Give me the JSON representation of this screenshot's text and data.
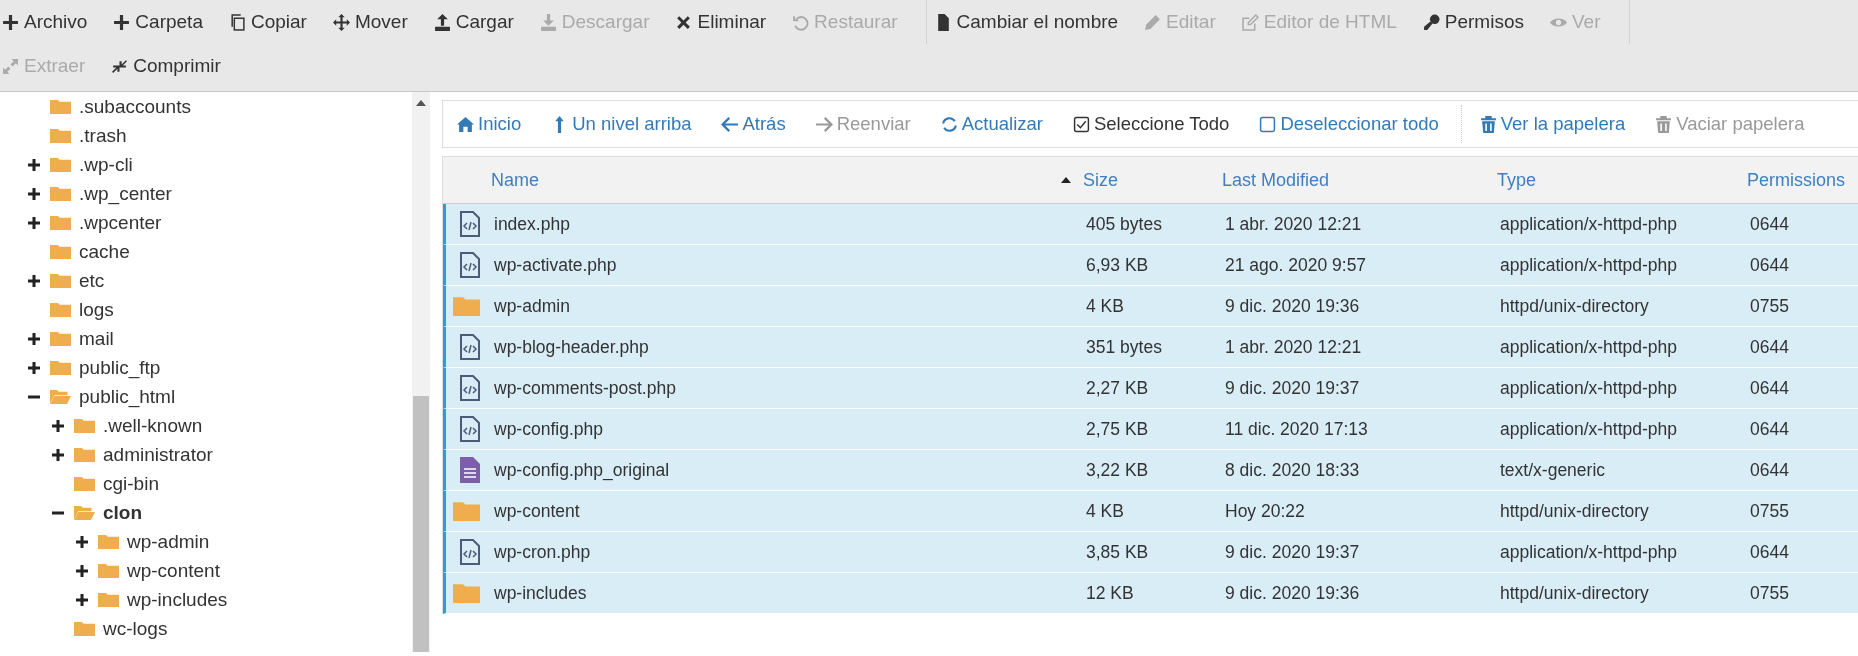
{
  "toolbar": {
    "groups": [
      {
        "items": [
          {
            "label": "Archivo",
            "disabled": false
          },
          {
            "label": "Carpeta",
            "disabled": false
          },
          {
            "label": "Copiar",
            "disabled": false
          },
          {
            "label": "Mover",
            "disabled": false
          },
          {
            "label": "Cargar",
            "disabled": false
          },
          {
            "label": "Descargar",
            "disabled": true
          },
          {
            "label": "Eliminar",
            "disabled": false
          },
          {
            "label": "Restaurar",
            "disabled": true
          }
        ]
      },
      {
        "items": [
          {
            "label": "Cambiar el nombre",
            "disabled": false
          },
          {
            "label": "Editar",
            "disabled": true
          },
          {
            "label": "Editor de HTML",
            "disabled": true
          },
          {
            "label": "Permisos",
            "disabled": false
          },
          {
            "label": "Ver",
            "disabled": true
          }
        ]
      },
      {
        "items": [
          {
            "label": "Extraer",
            "disabled": true
          },
          {
            "label": "Comprimir",
            "disabled": false
          }
        ]
      }
    ]
  },
  "tree": [
    {
      "label": ".subaccounts",
      "selected": false
    },
    {
      "label": ".trash",
      "selected": false
    },
    {
      "label": ".wp-cli",
      "selected": false,
      "expanded": false
    },
    {
      "label": ".wp_center",
      "selected": false,
      "expanded": false
    },
    {
      "label": ".wpcenter",
      "selected": false,
      "expanded": false
    },
    {
      "label": "cache",
      "selected": false
    },
    {
      "label": "etc",
      "selected": false,
      "expanded": false
    },
    {
      "label": "logs",
      "selected": false
    },
    {
      "label": "mail",
      "selected": false,
      "expanded": false
    },
    {
      "label": "public_ftp",
      "selected": false,
      "expanded": false
    },
    {
      "label": "public_html",
      "selected": false,
      "expanded": true,
      "children": [
        {
          "label": ".well-known",
          "selected": false,
          "expanded": false
        },
        {
          "label": "administrator",
          "selected": false,
          "expanded": false
        },
        {
          "label": "cgi-bin",
          "selected": false
        },
        {
          "label": "clon",
          "selected": true,
          "expanded": true,
          "children": [
            {
              "label": "wp-admin",
              "selected": false,
              "expanded": false
            },
            {
              "label": "wp-content",
              "selected": false,
              "expanded": false
            },
            {
              "label": "wp-includes",
              "selected": false,
              "expanded": false
            }
          ]
        },
        {
          "label": "wc-logs",
          "selected": false
        }
      ]
    }
  ],
  "nav": {
    "groups": [
      {
        "items": [
          {
            "label": "Inicio",
            "disabled": false
          },
          {
            "label": "Un nivel arriba",
            "disabled": false
          },
          {
            "label": "Atrás",
            "disabled": false
          },
          {
            "label": "Reenviar",
            "disabled": true
          },
          {
            "label": "Actualizar",
            "disabled": false
          },
          {
            "label": "Seleccione Todo",
            "disabled": false,
            "kind": "check"
          },
          {
            "label": "Deseleccionar todo",
            "disabled": false
          }
        ]
      },
      {
        "items": [
          {
            "label": "Ver la papelera",
            "disabled": false
          },
          {
            "label": "Vaciar papelera",
            "disabled": true
          }
        ]
      }
    ]
  },
  "table": {
    "columns": [
      {
        "label": "Name",
        "sorted": true
      },
      {
        "label": "Size",
        "sorted": false
      },
      {
        "label": "Last Modified",
        "sorted": false
      },
      {
        "label": "Type",
        "sorted": false
      },
      {
        "label": "Permissions",
        "sorted": false
      }
    ],
    "rows": [
      {
        "kind": "code",
        "selected": true,
        "name": "index.php",
        "size": "405 bytes",
        "modified": "1 abr. 2020 12:21",
        "type": "application/x-httpd-php",
        "permissions": "0644"
      },
      {
        "kind": "code",
        "selected": true,
        "name": "wp-activate.php",
        "size": "6,93 KB",
        "modified": "21 ago. 2020 9:57",
        "type": "application/x-httpd-php",
        "permissions": "0644"
      },
      {
        "kind": "folder",
        "selected": true,
        "name": "wp-admin",
        "size": "4 KB",
        "modified": "9 dic. 2020 19:36",
        "type": "httpd/unix-directory",
        "permissions": "0755"
      },
      {
        "kind": "code",
        "selected": true,
        "name": "wp-blog-header.php",
        "size": "351 bytes",
        "modified": "1 abr. 2020 12:21",
        "type": "application/x-httpd-php",
        "permissions": "0644"
      },
      {
        "kind": "code",
        "selected": true,
        "name": "wp-comments-post.php",
        "size": "2,27 KB",
        "modified": "9 dic. 2020 19:37",
        "type": "application/x-httpd-php",
        "permissions": "0644"
      },
      {
        "kind": "code",
        "selected": true,
        "name": "wp-config.php",
        "size": "2,75 KB",
        "modified": "11 dic. 2020 17:13",
        "type": "application/x-httpd-php",
        "permissions": "0644"
      },
      {
        "kind": "text",
        "selected": true,
        "name": "wp-config.php_original",
        "size": "3,22 KB",
        "modified": "8 dic. 2020 18:33",
        "type": "text/x-generic",
        "permissions": "0644"
      },
      {
        "kind": "folder",
        "selected": true,
        "name": "wp-content",
        "size": "4 KB",
        "modified": "Hoy 20:22",
        "type": "httpd/unix-directory",
        "permissions": "0755"
      },
      {
        "kind": "code",
        "selected": true,
        "name": "wp-cron.php",
        "size": "3,85 KB",
        "modified": "9 dic. 2020 19:37",
        "type": "application/x-httpd-php",
        "permissions": "0644"
      },
      {
        "kind": "folder",
        "selected": true,
        "name": "wp-includes",
        "size": "12 KB",
        "modified": "9 dic. 2020 19:36",
        "type": "httpd/unix-directory",
        "permissions": "0755"
      }
    ]
  }
}
